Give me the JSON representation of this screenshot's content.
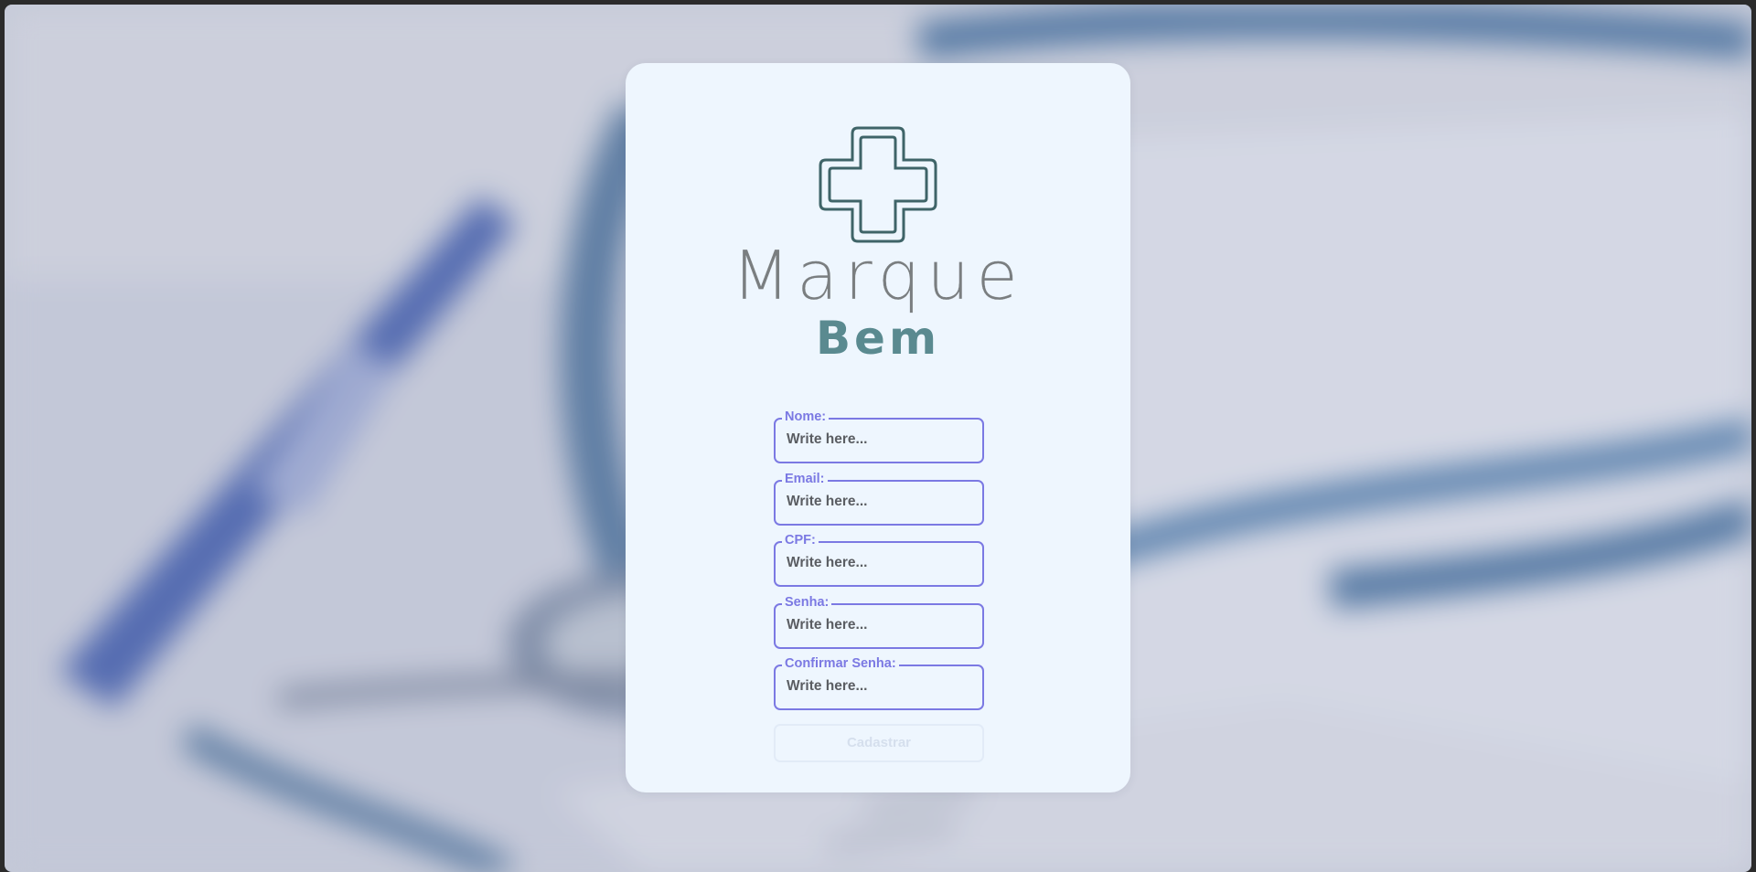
{
  "brand": {
    "name_line1": "Marque",
    "name_line2": "Bem",
    "logo_icon": "medical-cross-icon"
  },
  "form": {
    "fields": [
      {
        "label": "Nome:",
        "placeholder": "Write here..."
      },
      {
        "label": "Email:",
        "placeholder": "Write here..."
      },
      {
        "label": "CPF:",
        "placeholder": "Write here..."
      },
      {
        "label": "Senha:",
        "placeholder": "Write here..."
      },
      {
        "label": "Confirmar Senha:",
        "placeholder": "Write here..."
      }
    ],
    "submit_label": "Cadastrar"
  },
  "colors": {
    "card_background": "#eef6fe",
    "field_accent": "#7b79e3",
    "logo_stroke": "#3f6468",
    "brand_bottom": "#5a8a90",
    "brand_top": "#7a7e80"
  }
}
